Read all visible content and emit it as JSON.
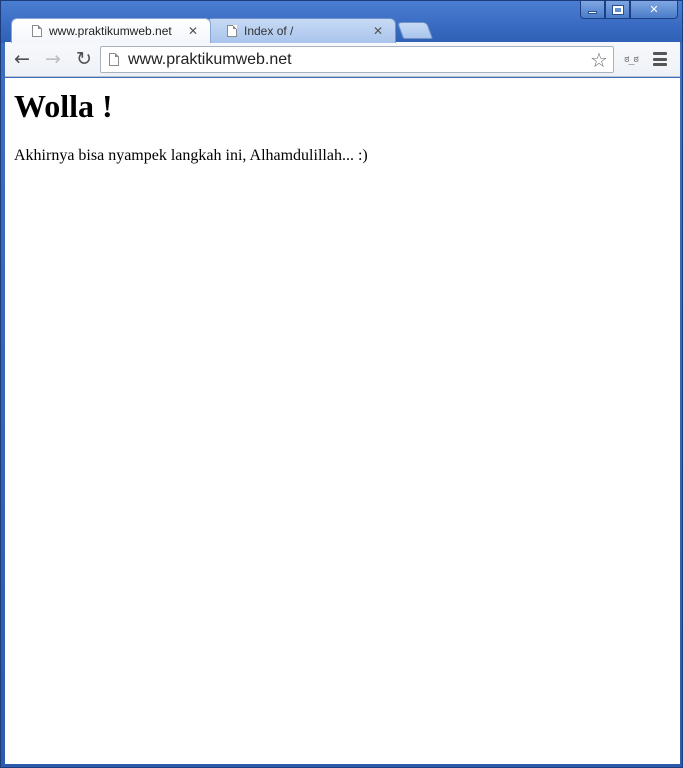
{
  "window": {
    "controls": {
      "minimize_icon": "minimize-icon",
      "maximize_icon": "maximize-icon",
      "close_icon": "close-icon",
      "close_glyph": "✕"
    }
  },
  "tabs": [
    {
      "title": "www.praktikumweb.net",
      "close_glyph": "✕",
      "icon": "page-icon",
      "active": true
    },
    {
      "title": "Index of /",
      "close_glyph": "✕",
      "icon": "page-icon",
      "active": false
    }
  ],
  "toolbar": {
    "back_glyph": "←",
    "forward_glyph": "→",
    "reload_glyph": "↻",
    "url": "www.praktikumweb.net",
    "bookmark_glyph": "☆",
    "extension_glyph": "ಠ_ಠ"
  },
  "page": {
    "heading": "Wolla !",
    "paragraph": "Akhirnya bisa nyampek langkah ini, Alhamdulillah... :)"
  },
  "colors": {
    "frame": "#3a6cc3",
    "tab_active": "#ffffff",
    "tab_inactive": "#b9cff0"
  }
}
